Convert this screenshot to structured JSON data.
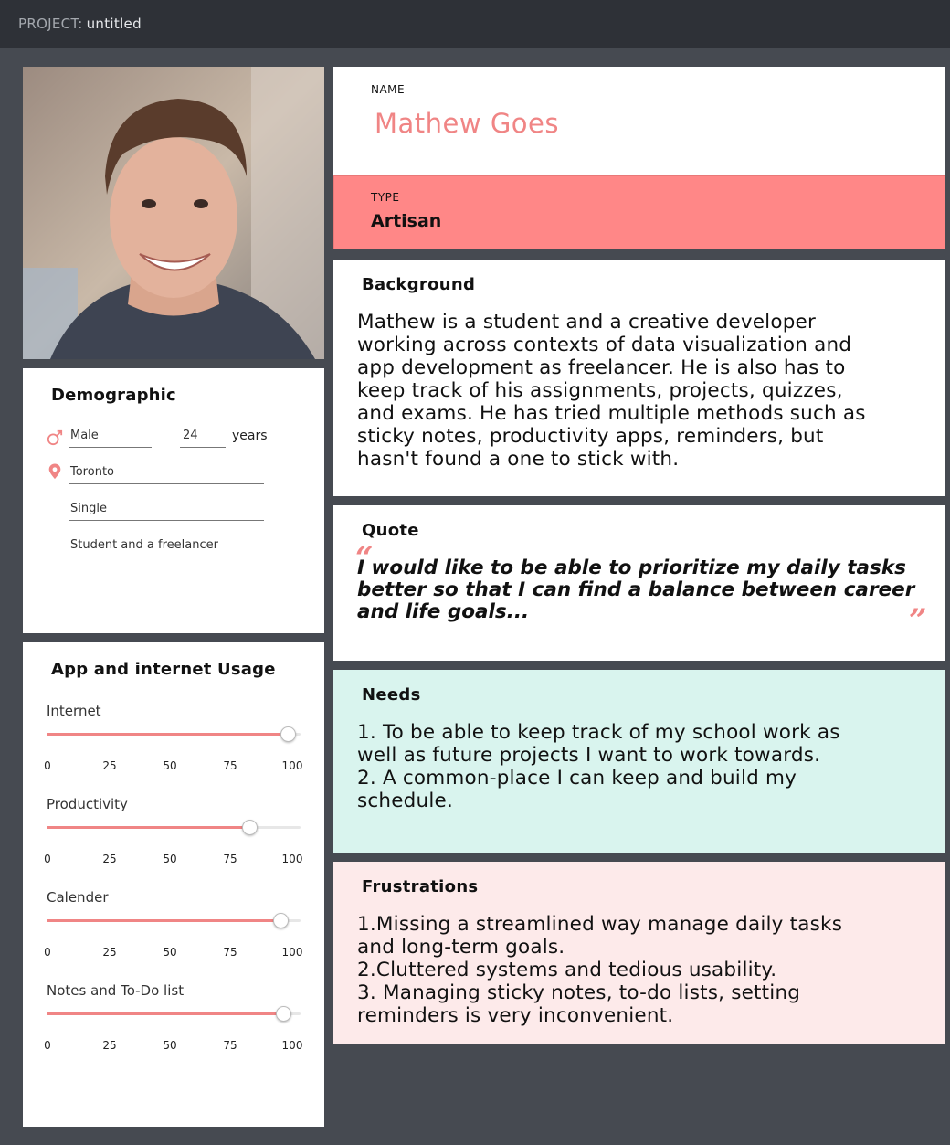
{
  "header": {
    "project_prefix": "PROJECT:",
    "project_name": "untitled"
  },
  "profile": {
    "name_label": "NAME",
    "name": "Mathew Goes",
    "type_label": "TYPE",
    "type": "Artisan"
  },
  "demographic": {
    "title": "Demographic",
    "gender": "Male",
    "age": "24",
    "age_unit": "years",
    "location": "Toronto",
    "status": "Single",
    "occupation": "Student and a freelancer"
  },
  "usage": {
    "title": "App and internet Usage",
    "scale": [
      "0",
      "25",
      "50",
      "75",
      "100"
    ],
    "items": [
      {
        "label": "Internet",
        "value": 95
      },
      {
        "label": "Productivity",
        "value": 80
      },
      {
        "label": "Calender",
        "value": 92
      },
      {
        "label": "Notes and To-Do list",
        "value": 93
      }
    ]
  },
  "background": {
    "title": "Background",
    "lines": [
      "Mathew is a student and a creative developer",
      "working across contexts of data visualization and",
      "app development as freelancer. He is also has to",
      "keep track of his assignments, projects, quizzes,",
      "and exams. He has tried multiple methods such as",
      "sticky notes, productivity apps, reminders, but",
      "hasn't found a one to stick with."
    ]
  },
  "quote": {
    "title": "Quote",
    "open_mark": "“",
    "close_mark": "”",
    "lines": [
      "I would like to be able to prioritize my daily tasks",
      "better so that I can find a balance between career",
      "and life goals..."
    ]
  },
  "needs": {
    "title": "Needs",
    "lines": [
      "1. To be able to keep track of my school work as",
      "well as future projects I want to work towards.",
      "2. A common-place I can keep and build my",
      "schedule."
    ]
  },
  "frustrations": {
    "title": "Frustrations",
    "lines": [
      "1.Missing a streamlined way manage daily tasks",
      "and long-term goals.",
      "2.Cluttered systems and tedious usability.",
      "3. Managing sticky notes, to-do lists, setting",
      "reminders is very inconvenient."
    ]
  },
  "colors": {
    "accent": "#f08585",
    "type_bg": "#ff8787",
    "needs_bg": "#d9f4ee",
    "frustrations_bg": "#fdeaea"
  },
  "icons": {
    "gender": "male-symbol-icon",
    "location": "location-pin-icon"
  }
}
